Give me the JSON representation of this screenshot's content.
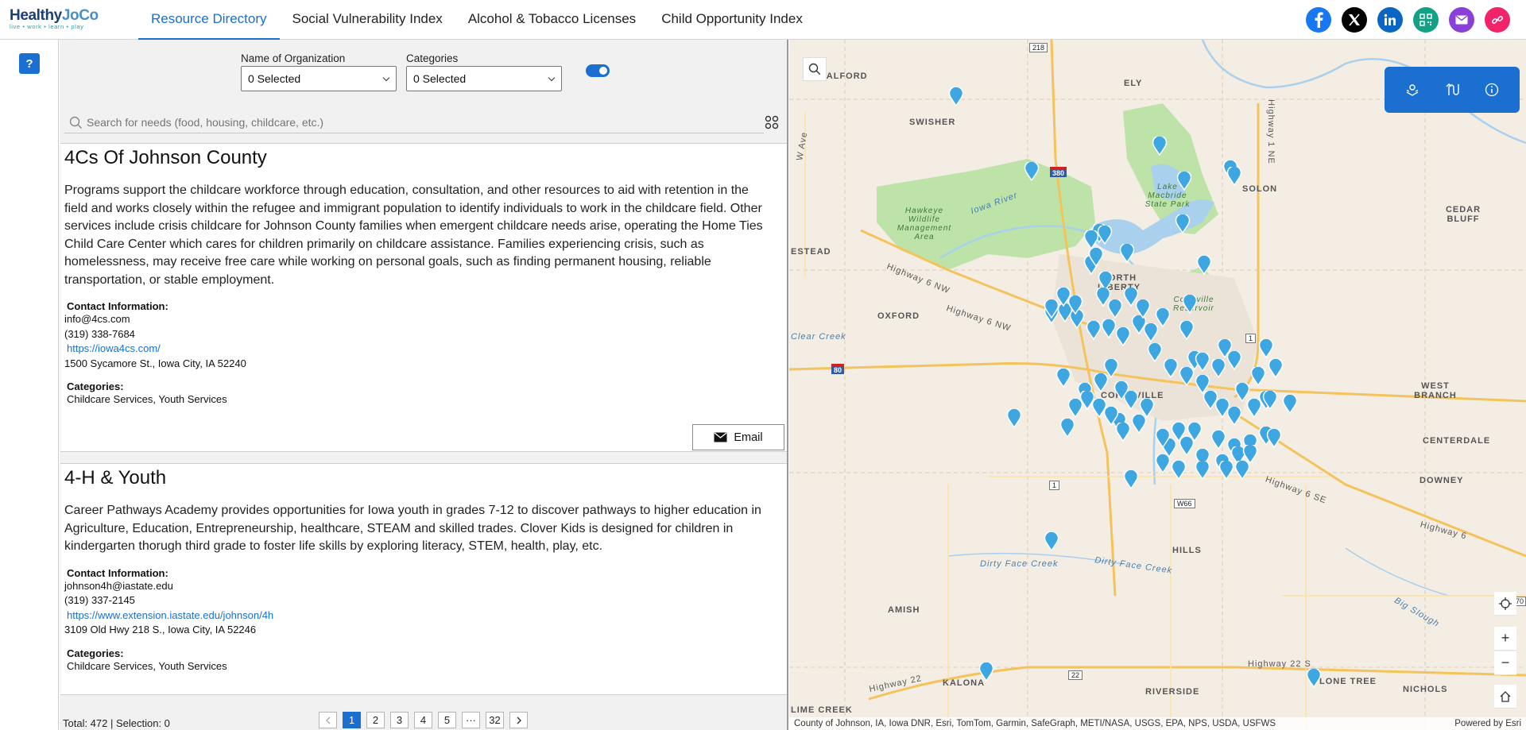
{
  "brand": {
    "logo_main_1": "Healthy",
    "logo_main_2": "JoCo",
    "tagline": "live • work • learn • play"
  },
  "nav": {
    "tabs": [
      {
        "label": "Resource Directory"
      },
      {
        "label": "Social Vulnerability Index"
      },
      {
        "label": "Alcohol & Tobacco Licenses"
      },
      {
        "label": "Child Opportunity Index"
      }
    ]
  },
  "social": {
    "colors": {
      "facebook": "#1877f2",
      "x": "#000000",
      "linkedin": "#0a66c2",
      "qr": "#14a085",
      "mail": "#8b3fd9",
      "share": "#f0236b"
    }
  },
  "help": {
    "label": "?"
  },
  "filters": {
    "org_label": "Name of Organization",
    "org_value": "0 Selected",
    "cat_label": "Categories",
    "cat_value": "0 Selected"
  },
  "search": {
    "placeholder": "Search for needs (food, housing, childcare, etc.)"
  },
  "cards": [
    {
      "title": "4Cs Of Johnson County",
      "description": " Programs support the childcare workforce through education, consultation, and other resources to aid with retention in the field and works closely within the refugee and immigrant population to identify individuals to work in the childcare field. Other services include crisis childcare for Johnson County families when emergent childcare needs arise, operating the Home Ties Child Care Center which cares for children primarily on childcare assistance. Families experiencing crisis, such as homelessness, may receive free care while working on personal goals, such as finding permanent housing, reliable transportation, or stable employment.",
      "contact_label": "Contact Information:",
      "email": "info@4cs.com",
      "phone": "(319) 338-7684",
      "url": "https://iowa4cs.com/",
      "address": "1500 Sycamore St., Iowa City, IA 52240",
      "categories_label": "Categories:",
      "categories": "Childcare Services, Youth Services",
      "email_button": "Email"
    },
    {
      "title": "4-H & Youth",
      "description": " Career Pathways Academy provides opportunities for Iowa youth in grades 7-12 to discover pathways to higher education in Agriculture, Education, Entrepreneurship, healthcare, STEAM and skilled trades.  Clover Kids is designed for children in kindergarten thorugh third grade to foster life skills by exploring literacy, STEM, health, play, etc.",
      "contact_label": "Contact Information:",
      "email": "johnson4h@iastate.edu",
      "phone": "(319) 337-2145",
      "url": "https://www.extension.iastate.edu/johnson/4h",
      "address": "3109 Old Hwy 218 S., Iowa City, IA 52246",
      "categories_label": "Categories:",
      "categories": "Childcare Services, Youth Services"
    }
  ],
  "footer": {
    "total": "Total: 472 | Selection: 0",
    "pages": [
      "1",
      "2",
      "3",
      "4",
      "5",
      "···",
      "32"
    ],
    "current_page": "1"
  },
  "map": {
    "labels": [
      {
        "text": "WALFORD"
      },
      {
        "text": "SWISHER"
      },
      {
        "text": "ELY"
      },
      {
        "text": "SOLON"
      },
      {
        "text": "CEDAR BLUFF"
      },
      {
        "text": "OXFORD"
      },
      {
        "text": "NORTH LIBERTY"
      },
      {
        "text": "CORALVILLE"
      },
      {
        "text": "WEST BRANCH"
      },
      {
        "text": "CENTERDALE"
      },
      {
        "text": "DOWNEY"
      },
      {
        "text": "HILLS"
      },
      {
        "text": "AMISH"
      },
      {
        "text": "KALONA"
      },
      {
        "text": "RIVERSIDE"
      },
      {
        "text": "LONE TREE"
      },
      {
        "text": "NICHOLS"
      },
      {
        "text": "ESTEAD"
      },
      {
        "text": "LIME CREEK"
      }
    ],
    "road_labels": [
      "Highway 6 NW",
      "Highway 6 NW",
      "Highway 6 SE",
      "Highway 6",
      "Highway 22",
      "Highway 22 S",
      "Highway 1 NE",
      "W Ave",
      "Iowa River",
      "Dirty Face Creek",
      "Dirty Face Creek",
      "Big Slough",
      "Clear Creek",
      "Hawkeye Wildlife Management Area",
      "Lake Macbride State Park",
      "Coralville Reservoir"
    ],
    "shields": [
      "218",
      "380",
      "80",
      "1",
      "1",
      "W66",
      "22",
      "70"
    ],
    "attribution": "County of Johnson, IA, Iowa DNR, Esri, TomTom, Garmin, SafeGraph, METI/NASA, USGS, EPA, NPS, USDA, USFWS",
    "powered_by": "Powered by Esri",
    "pin_color": "#3ea6e0"
  }
}
